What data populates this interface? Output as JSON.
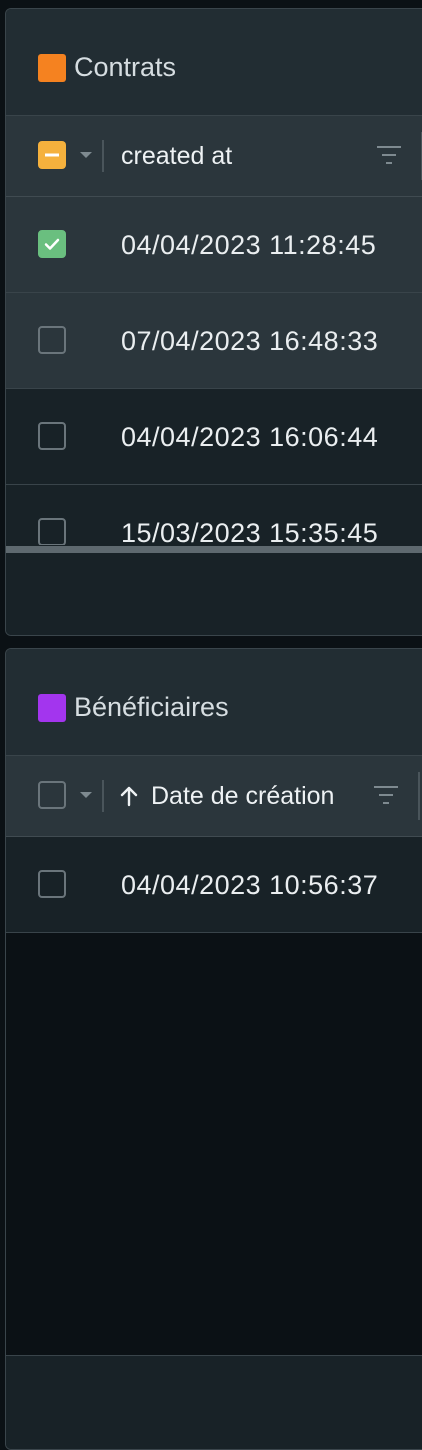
{
  "contrats": {
    "title": "Contrats",
    "title_color": "#f58220",
    "column": {
      "label": "created at"
    },
    "header_checkbox_state": "indeterminate",
    "rows": [
      {
        "checked": true,
        "created_at": "04/04/2023 11:28:45"
      },
      {
        "checked": false,
        "created_at": "07/04/2023 16:48:33"
      },
      {
        "checked": false,
        "created_at": "04/04/2023 16:06:44"
      },
      {
        "checked": false,
        "created_at": "15/03/2023 15:35:45"
      }
    ]
  },
  "beneficiaires": {
    "title": "Bénéficiaires",
    "title_color": "#a335ee",
    "column": {
      "label": "Date de création",
      "sort": "ascending"
    },
    "header_checkbox_state": "unchecked",
    "rows": [
      {
        "checked": false,
        "created_at": "04/04/2023 10:56:37"
      }
    ]
  },
  "colors": {
    "indeterminate": "#f5b13d",
    "checked": "#6abf7f"
  },
  "icons": {
    "check": "check-icon",
    "minus": "minus-icon",
    "filter": "filter-icon",
    "sort": "arrow-up-icon",
    "chevron": "chevron-down-icon"
  }
}
